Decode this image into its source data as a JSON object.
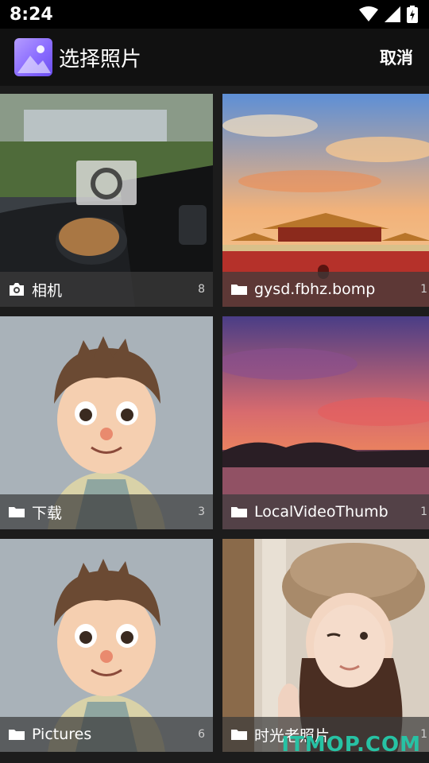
{
  "status": {
    "time": "8:24"
  },
  "header": {
    "title": "选择照片",
    "cancel_label": "取消"
  },
  "albums": [
    {
      "name": "相机",
      "count": "8",
      "icon": "camera-icon"
    },
    {
      "name": "gysd.fbhz.bomp",
      "count": "1",
      "icon": "folder-icon"
    },
    {
      "name": "下载",
      "count": "3",
      "icon": "folder-icon"
    },
    {
      "name": "LocalVideoThumb",
      "count": "1",
      "icon": "folder-icon"
    },
    {
      "name": "Pictures",
      "count": "6",
      "icon": "folder-icon"
    },
    {
      "name": "时光老照片",
      "count": "1",
      "icon": "folder-icon"
    }
  ],
  "watermark": "ITMOP.COM"
}
